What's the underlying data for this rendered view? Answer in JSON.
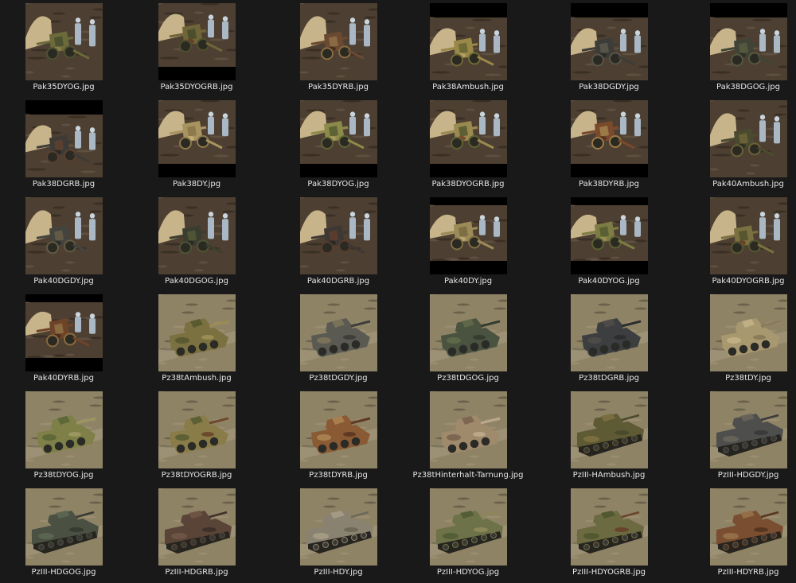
{
  "view": {
    "background": "#191919",
    "label_color": "#e6e6e6"
  },
  "files": [
    {
      "name": "Pak35DYOG.jpg",
      "subject": "pak-gun",
      "camo": "dark-yellow-olive-green",
      "colors": [
        "#6b6a3a",
        "#4c5230",
        "#8a7c4a"
      ],
      "letterbox": "none"
    },
    {
      "name": "Pak35DYOGRB.jpg",
      "subject": "pak-gun",
      "camo": "dark-yellow-olive-green-red-brown",
      "colors": [
        "#6f6538",
        "#4d4f2c",
        "#6a3f28"
      ],
      "letterbox": "bottom"
    },
    {
      "name": "Pak35DYRB.jpg",
      "subject": "pak-gun",
      "camo": "dark-yellow-red-brown",
      "colors": [
        "#6a4a30",
        "#8a6a42",
        "#4a3020"
      ],
      "letterbox": "none"
    },
    {
      "name": "Pak38Ambush.jpg",
      "subject": "pak-gun",
      "camo": "ambush",
      "colors": [
        "#9a8848",
        "#6e6a36",
        "#b3a060"
      ],
      "letterbox": "top"
    },
    {
      "name": "Pak38DGDY.jpg",
      "subject": "pak-gun",
      "camo": "dark-grey-dark-yellow",
      "colors": [
        "#3c3c38",
        "#57544a",
        "#2a2a28"
      ],
      "letterbox": "top"
    },
    {
      "name": "Pak38DGOG.jpg",
      "subject": "pak-gun",
      "camo": "dark-grey-olive-green",
      "colors": [
        "#3f4436",
        "#55583e",
        "#2e3028"
      ],
      "letterbox": "top"
    },
    {
      "name": "Pak38DGRB.jpg",
      "subject": "pak-gun",
      "camo": "dark-grey-red-brown",
      "colors": [
        "#3e3a36",
        "#5a4030",
        "#2c2a28"
      ],
      "letterbox": "top"
    },
    {
      "name": "Pak38DY.jpg",
      "subject": "pak-gun",
      "camo": "dark-yellow",
      "colors": [
        "#a89460",
        "#8c7a4c",
        "#c2ae78"
      ],
      "letterbox": "bottom"
    },
    {
      "name": "Pak38DYOG.jpg",
      "subject": "pak-gun",
      "camo": "dark-yellow-olive-green",
      "colors": [
        "#8c8a4a",
        "#5e6334",
        "#a89a5a"
      ],
      "letterbox": "bottom"
    },
    {
      "name": "Pak38DYOGRB.jpg",
      "subject": "pak-gun",
      "camo": "dark-yellow-olive-green-red-brown",
      "colors": [
        "#9a8a50",
        "#5e6034",
        "#7a4a2c"
      ],
      "letterbox": "bottom"
    },
    {
      "name": "Pak38DYRB.jpg",
      "subject": "pak-gun",
      "camo": "dark-yellow-red-brown",
      "colors": [
        "#7a4a2c",
        "#9c7a48",
        "#5a3420"
      ],
      "letterbox": "bottom"
    },
    {
      "name": "Pak40Ambush.jpg",
      "subject": "pak-gun",
      "camo": "ambush",
      "colors": [
        "#4a4a30",
        "#6a6236",
        "#323222"
      ],
      "letterbox": "none"
    },
    {
      "name": "Pak40DGDY.jpg",
      "subject": "pak-gun",
      "camo": "dark-grey-dark-yellow",
      "colors": [
        "#44443e",
        "#625a44",
        "#2e2e2a"
      ],
      "letterbox": "none"
    },
    {
      "name": "Pak40DGOG.jpg",
      "subject": "pak-gun",
      "camo": "dark-grey-olive-green",
      "colors": [
        "#3a3e30",
        "#4e5434",
        "#2a2c24"
      ],
      "letterbox": "none"
    },
    {
      "name": "Pak40DGRB.jpg",
      "subject": "pak-gun",
      "camo": "dark-grey-red-brown",
      "colors": [
        "#3e3834",
        "#5a3c2c",
        "#2a2826"
      ],
      "letterbox": "none"
    },
    {
      "name": "Pak40DY.jpg",
      "subject": "pak-gun",
      "camo": "dark-yellow",
      "colors": [
        "#9c8a58",
        "#7e6e44",
        "#b8a470"
      ],
      "letterbox": "both"
    },
    {
      "name": "Pak40DYOG.jpg",
      "subject": "pak-gun",
      "camo": "dark-yellow-olive-green",
      "colors": [
        "#7c7c44",
        "#5a6034",
        "#9a8c52"
      ],
      "letterbox": "both"
    },
    {
      "name": "Pak40DYOGRB.jpg",
      "subject": "pak-gun",
      "camo": "dark-yellow-olive-green-red-brown",
      "colors": [
        "#7a7040",
        "#565630",
        "#6a4028"
      ],
      "letterbox": "none"
    },
    {
      "name": "Pak40DYRB.jpg",
      "subject": "pak-gun",
      "camo": "dark-yellow-red-brown",
      "colors": [
        "#6e4428",
        "#8a6a40",
        "#4e301e"
      ],
      "letterbox": "both"
    },
    {
      "name": "Pz38tAmbush.jpg",
      "subject": "pz38t-tank",
      "camo": "ambush",
      "colors": [
        "#7a7040",
        "#5a5a30",
        "#9a8c52"
      ],
      "letterbox": "none"
    },
    {
      "name": "Pz38tDGDY.jpg",
      "subject": "pz38t-tank",
      "camo": "dark-grey-dark-yellow",
      "colors": [
        "#5a5a52",
        "#7a7258",
        "#3e3e3a"
      ],
      "letterbox": "none"
    },
    {
      "name": "Pz38tDGOG.jpg",
      "subject": "pz38t-tank",
      "camo": "dark-grey-olive-green",
      "colors": [
        "#4a5240",
        "#5e6848",
        "#363c30"
      ],
      "letterbox": "none"
    },
    {
      "name": "Pz38tDGRB.jpg",
      "subject": "pz38t-tank",
      "camo": "dark-grey-red-brown",
      "colors": [
        "#3c3e40",
        "#4e4a48",
        "#2c2e30"
      ],
      "letterbox": "none"
    },
    {
      "name": "Pz38tDY.jpg",
      "subject": "pz38t-tank",
      "camo": "dark-yellow",
      "colors": [
        "#a89870",
        "#c0ae84",
        "#8a7c58"
      ],
      "letterbox": "none"
    },
    {
      "name": "Pz38tDYOG.jpg",
      "subject": "pz38t-tank",
      "camo": "dark-yellow-olive-green",
      "colors": [
        "#7e8048",
        "#5e6838",
        "#9c9660"
      ],
      "letterbox": "none"
    },
    {
      "name": "Pz38tDYOGRB.jpg",
      "subject": "pz38t-tank",
      "camo": "dark-yellow-olive-green-red-brown",
      "colors": [
        "#8a7c48",
        "#5c6034",
        "#6e4a2c"
      ],
      "letterbox": "none"
    },
    {
      "name": "Pz38tDYRB.jpg",
      "subject": "pz38t-tank",
      "camo": "dark-yellow-red-brown",
      "colors": [
        "#8a5a34",
        "#a88050",
        "#5e3a22"
      ],
      "letterbox": "none"
    },
    {
      "name": "Pz38tHinterhalt-Tarnung.jpg",
      "subject": "pz38t-tank",
      "camo": "hinterhalt-tarnung",
      "colors": [
        "#a08a6c",
        "#7e6650",
        "#bca888"
      ],
      "letterbox": "none"
    },
    {
      "name": "PzIII-HAmbush.jpg",
      "subject": "pziii-tank",
      "camo": "ambush",
      "colors": [
        "#5e5a34",
        "#7a6e40",
        "#4a4a2c"
      ],
      "letterbox": "none"
    },
    {
      "name": "PzIII-HDGDY.jpg",
      "subject": "pziii-tank",
      "camo": "dark-grey-dark-yellow",
      "colors": [
        "#4e4e4c",
        "#66625a",
        "#3a3a3a"
      ],
      "letterbox": "none"
    },
    {
      "name": "PzIII-HDGOG.jpg",
      "subject": "pziii-tank",
      "camo": "dark-grey-olive-green",
      "colors": [
        "#4a5042",
        "#5a6450",
        "#363a30"
      ],
      "letterbox": "none"
    },
    {
      "name": "PzIII-HDGRB.jpg",
      "subject": "pziii-tank",
      "camo": "dark-grey-red-brown",
      "colors": [
        "#5a4438",
        "#6e5444",
        "#3e302a"
      ],
      "letterbox": "none"
    },
    {
      "name": "PzIII-HDY.jpg",
      "subject": "pziii-tank",
      "camo": "dark-yellow",
      "colors": [
        "#8a8270",
        "#a49a84",
        "#6e6858"
      ],
      "letterbox": "none"
    },
    {
      "name": "PzIII-HDYOG.jpg",
      "subject": "pziii-tank",
      "camo": "dark-yellow-olive-green",
      "colors": [
        "#6e7248",
        "#545e36",
        "#8c8658"
      ],
      "letterbox": "none"
    },
    {
      "name": "PzIII-HDYOGRB.jpg",
      "subject": "pziii-tank",
      "camo": "dark-yellow-olive-green-red-brown",
      "colors": [
        "#6c6a40",
        "#525830",
        "#6a442a"
      ],
      "letterbox": "none"
    },
    {
      "name": "PzIII-HDYRB.jpg",
      "subject": "pziii-tank",
      "camo": "dark-yellow-red-brown",
      "colors": [
        "#7a4e30",
        "#946e48",
        "#573620"
      ],
      "letterbox": "none"
    }
  ]
}
